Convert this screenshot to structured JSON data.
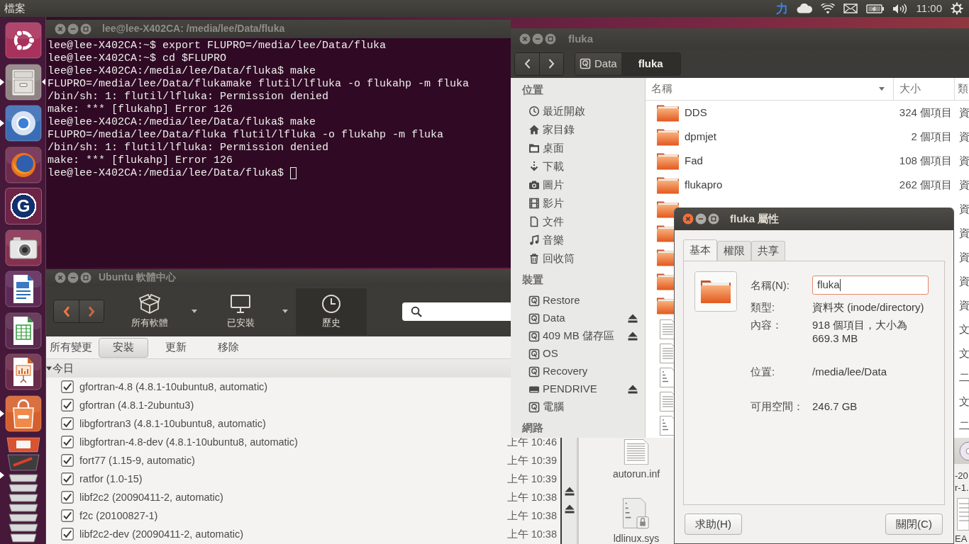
{
  "top_panel": {
    "app_menu": "檔案",
    "input_method": "力",
    "clock": "11:00"
  },
  "launcher": [
    {
      "kind": "dash",
      "running": false,
      "focused": false
    },
    {
      "kind": "files",
      "running": true,
      "focused": true
    },
    {
      "kind": "browser",
      "running": true,
      "focused": false
    },
    {
      "kind": "firefox",
      "running": false,
      "focused": false
    },
    {
      "kind": "letter",
      "label": "G",
      "running": false,
      "focused": false
    },
    {
      "kind": "camera",
      "running": false,
      "focused": false
    },
    {
      "kind": "writer",
      "running": false,
      "focused": false
    },
    {
      "kind": "calc",
      "running": false,
      "focused": false
    },
    {
      "kind": "impress",
      "running": false,
      "focused": false
    },
    {
      "kind": "software",
      "running": true,
      "focused": false
    },
    {
      "kind": "stack",
      "running": true,
      "focused": false
    }
  ],
  "terminal": {
    "title": "lee@lee-X402CA: /media/lee/Data/fluka",
    "focused": false,
    "lines": [
      "lee@lee-X402CA:~$ export FLUPRO=/media/lee/Data/fluka",
      "lee@lee-X402CA:~$ cd $FLUPRO",
      "lee@lee-X402CA:/media/lee/Data/fluka$ make",
      "FLUPRO=/media/lee/Data/flukamake flutil/lfluka -o flukahp -m fluka",
      "/bin/sh: 1: flutil/lfluka: Permission denied",
      "make: *** [flukahp] Error 126",
      "lee@lee-X402CA:/media/lee/Data/fluka$ make",
      "FLUPRO=/media/lee/Data/fluka flutil/lfluka -o flukahp -m fluka",
      "/bin/sh: 1: flutil/lfluka: Permission denied",
      "make: *** [flukahp] Error 126",
      "lee@lee-X402CA:/media/lee/Data/fluka$"
    ],
    "cursor": true
  },
  "software_center": {
    "title": "Ubuntu 軟體中心",
    "focused": false,
    "toolbar": [
      {
        "kind": "catalog",
        "label": "所有軟體",
        "dropdown": true,
        "selected": false
      },
      {
        "kind": "installed",
        "label": "已安裝",
        "dropdown": true,
        "selected": false
      },
      {
        "kind": "history",
        "label": "歷史",
        "dropdown": false,
        "selected": true
      }
    ],
    "filters": [
      {
        "label": "所有變更",
        "selected": false
      },
      {
        "label": "安裝",
        "selected": true
      },
      {
        "label": "更新",
        "selected": false
      },
      {
        "label": "移除",
        "selected": false
      }
    ],
    "groups": [
      {
        "label": "今日",
        "expanded": true,
        "rows": [
          {
            "name": "gfortran-4.8 (4.8.1-10ubuntu8, automatic)",
            "checked": true
          },
          {
            "name": "gfortran (4.8.1-2ubuntu3)",
            "checked": true
          },
          {
            "name": "libgfortran3 (4.8.1-10ubuntu8, automatic)",
            "checked": true
          },
          {
            "name": "libgfortran-4.8-dev (4.8.1-10ubuntu8, automatic)",
            "checked": true,
            "time": "上午 10:46"
          },
          {
            "name": "fort77 (1.15-9, automatic)",
            "checked": true,
            "time": "上午 10:39"
          },
          {
            "name": "ratfor (1.0-15)",
            "checked": true,
            "time": "上午 10:39"
          },
          {
            "name": "libf2c2 (20090411-2, automatic)",
            "checked": true,
            "time": "上午 10:38"
          },
          {
            "name": "f2c (20100827-1)",
            "checked": true,
            "time": "上午 10:38"
          },
          {
            "name": "libf2c2-dev (20090411-2, automatic)",
            "checked": true,
            "time": "上午 10:38"
          }
        ]
      }
    ]
  },
  "file_manager": {
    "title": "fluka",
    "focused": false,
    "path": [
      {
        "kind": "drive",
        "label": "Data",
        "selected": false
      },
      {
        "kind": "plain",
        "label": "fluka",
        "selected": true
      }
    ],
    "sidebar": [
      {
        "heading": "位置",
        "items": [
          {
            "kind": "recent",
            "label": "最近開啟",
            "ejectable": false
          },
          {
            "kind": "home",
            "label": "家目錄",
            "ejectable": false
          },
          {
            "kind": "desktop",
            "label": "桌面",
            "ejectable": false
          },
          {
            "kind": "downloads",
            "label": "下載",
            "ejectable": false
          },
          {
            "kind": "pictures",
            "label": "圖片",
            "ejectable": false
          },
          {
            "kind": "videos",
            "label": "影片",
            "ejectable": false
          },
          {
            "kind": "documents",
            "label": "文件",
            "ejectable": false
          },
          {
            "kind": "music",
            "label": "音樂",
            "ejectable": false
          },
          {
            "kind": "trash",
            "label": "回收筒",
            "ejectable": false
          }
        ]
      },
      {
        "heading": "裝置",
        "items": [
          {
            "kind": "disk",
            "label": "Restore",
            "ejectable": false
          },
          {
            "kind": "disk",
            "label": "Data",
            "ejectable": true
          },
          {
            "kind": "disk",
            "label": "409 MB 儲存區",
            "ejectable": true
          },
          {
            "kind": "disk",
            "label": "OS",
            "ejectable": false
          },
          {
            "kind": "disk",
            "label": "Recovery",
            "ejectable": false
          },
          {
            "kind": "removable",
            "label": "PENDRIVE",
            "ejectable": true
          },
          {
            "kind": "disk",
            "label": "電腦",
            "ejectable": false
          }
        ]
      },
      {
        "heading": "網路"
      }
    ],
    "columns": [
      {
        "label": "名稱",
        "sorted": true
      },
      {
        "label": "大小",
        "sorted": false
      },
      {
        "label": "類",
        "sorted": false
      }
    ],
    "rows": [
      {
        "kind": "folder",
        "name": "DDS",
        "size": "324 個項目",
        "type": "資"
      },
      {
        "kind": "folder",
        "name": "dpmjet",
        "size": "2 個項目",
        "type": "資"
      },
      {
        "kind": "folder",
        "name": "Fad",
        "size": "108 個項目",
        "type": "資"
      },
      {
        "kind": "folder",
        "name": "flukapro",
        "size": "262 個項目",
        "type": "資"
      },
      {
        "kind": "folder",
        "type": "資"
      },
      {
        "kind": "folder",
        "type": "資"
      },
      {
        "kind": "folder",
        "type": "資"
      },
      {
        "kind": "folder",
        "type": "資"
      },
      {
        "kind": "folder",
        "type": "資"
      },
      {
        "kind": "text",
        "type": "文"
      },
      {
        "kind": "text",
        "type": "文"
      },
      {
        "kind": "binary",
        "type": "二"
      },
      {
        "kind": "text",
        "type": "文"
      },
      {
        "kind": "binary",
        "type": "二"
      }
    ]
  },
  "properties_dialog": {
    "title": "fluka 屬性",
    "focused": true,
    "tabs": [
      {
        "label": "基本",
        "selected": true
      },
      {
        "label": "權限",
        "selected": false
      },
      {
        "label": "共享",
        "selected": false
      }
    ],
    "fields": [
      {
        "kind": "entry",
        "label": "名稱(N):",
        "value": "fluka",
        "focused": true
      },
      {
        "kind": "text",
        "label": "類型:",
        "value": "資料夾 (inode/directory)"
      },
      {
        "kind": "text",
        "label": "內容：",
        "value": "918 個項目，大小為 669.3 MB"
      },
      {
        "kind": "text",
        "label": "位置:",
        "value": "/media/lee/Data"
      },
      {
        "kind": "text",
        "label": "可用空間：",
        "value": "246.7 GB"
      }
    ],
    "buttons": [
      {
        "label": "求助(H)"
      },
      {
        "label": "關閉(C)"
      }
    ]
  },
  "background_files": {
    "sidebar": [
      {
        "ejectable": true
      },
      {
        "ejectable": true
      }
    ],
    "items": [
      {
        "kind": "text",
        "name": "autorun.inf"
      },
      {
        "kind": "binary-locked",
        "name": "ldlinux.sys"
      }
    ],
    "edge_items": [
      {
        "kind": "disc"
      },
      {
        "kind": "label",
        "text": "-20"
      },
      {
        "kind": "label",
        "text": "r-1."
      },
      {
        "kind": "text"
      },
      {
        "kind": "label",
        "text": "EA"
      }
    ]
  }
}
